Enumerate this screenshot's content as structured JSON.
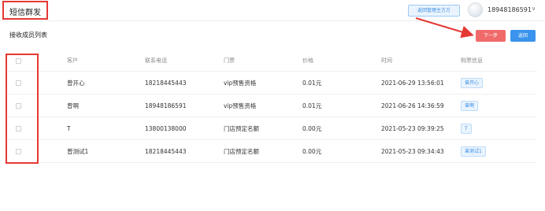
{
  "header": {
    "title": "短信群发",
    "switch_button": "返回管理主方方",
    "username": "18948186591",
    "dropdown_glyph": "∨"
  },
  "section": {
    "title": "接收成员列表",
    "next_button": "下一步",
    "back_button": "返回"
  },
  "table": {
    "columns": [
      "客户",
      "联系电话",
      "门票",
      "价格",
      "时间",
      "购票信息"
    ],
    "rows": [
      {
        "customer": "曾开心",
        "phone": "18218445443",
        "ticket": "vip预售资格",
        "price": "0.01元",
        "time": "2021-06-29 13:56:01",
        "tag": "曾开心"
      },
      {
        "customer": "曾啊",
        "phone": "18948186591",
        "ticket": "vip预售资格",
        "price": "0.01元",
        "time": "2021-06-26 14:36:59",
        "tag": "曾啊"
      },
      {
        "customer": "T",
        "phone": "13800138000",
        "ticket": "门店预定名额",
        "price": "0.00元",
        "time": "2021-05-23 09:39:25",
        "tag": "T"
      },
      {
        "customer": "曾测试1",
        "phone": "18218445443",
        "ticket": "门店预定名额",
        "price": "0.00元",
        "time": "2021-05-23 09:34:43",
        "tag": "曾测试1"
      }
    ]
  },
  "annotation_color": "#e53935",
  "accent_colors": {
    "primary": "#3a93ec",
    "danger": "#f06a6a",
    "tag": "#3b8fe0"
  },
  "icons": {
    "user": "avatar",
    "dropdown": "chevron-down-icon",
    "annotation": "arrow-icon"
  }
}
